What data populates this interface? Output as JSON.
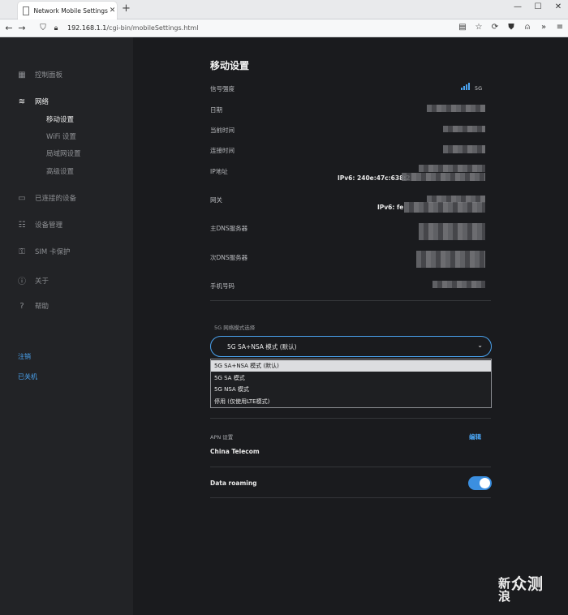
{
  "browser": {
    "tab_title": "Network Mobile Settings",
    "tab_close": "✕",
    "new_tab": "+",
    "url_host": "192.168.1.1",
    "url_path": "/cgi-bin/mobileSettings.html",
    "win_minimize": "—",
    "win_maximize": "☐",
    "win_close": "✕"
  },
  "sidebar": {
    "items": [
      {
        "label": "控制面板",
        "icon": "dashboard-icon"
      },
      {
        "label": "网络",
        "icon": "wifi-icon"
      },
      {
        "label": "已连接的设备",
        "icon": "devices-icon"
      },
      {
        "label": "设备管理",
        "icon": "settings-sliders-icon"
      },
      {
        "label": "SIM 卡保护",
        "icon": "lock-icon"
      },
      {
        "label": "关于",
        "icon": "info-icon"
      },
      {
        "label": "帮助",
        "icon": "help-icon"
      }
    ],
    "sub_items": [
      "移动设置",
      "WiFi 设置",
      "局域网设置",
      "高级设置"
    ],
    "logout": "注销",
    "shutdown": "已关机"
  },
  "main": {
    "title": "移动设置",
    "rows": {
      "signal": "信号强度",
      "date": "日期",
      "current_time": "当前时间",
      "connected_time": "连接时间",
      "ip": "IP地址",
      "gateway": "网关",
      "primary_dns": "主DNS服务器",
      "secondary_dns": "次DNS服务器",
      "phone": "手机号码"
    },
    "signal_type": "5G",
    "signal_level": 4,
    "ipv6_ip": "IPv6: 240e:47c:638:2",
    "ipv6_gw": "IPv6: fe",
    "mode_section_label": "5G 网络模式选择",
    "mode_selected": "5G SA+NSA 模式 (默认)",
    "mode_options": [
      "5G SA+NSA 模式 (默认)",
      "5G SA 模式",
      "5G NSA 模式",
      "停用 (仅使用LTE模式)"
    ],
    "apn_label": "APN 设置",
    "apn_edit": "编辑",
    "apn_value": "China Telecom",
    "roaming_label": "Data roaming",
    "roaming_on": true
  },
  "watermark": {
    "line1": "新浪",
    "line2": "众测"
  },
  "colors": {
    "accent": "#4aa3f0",
    "sidebar_bg": "#222326",
    "content_bg": "#1a1b1e"
  }
}
